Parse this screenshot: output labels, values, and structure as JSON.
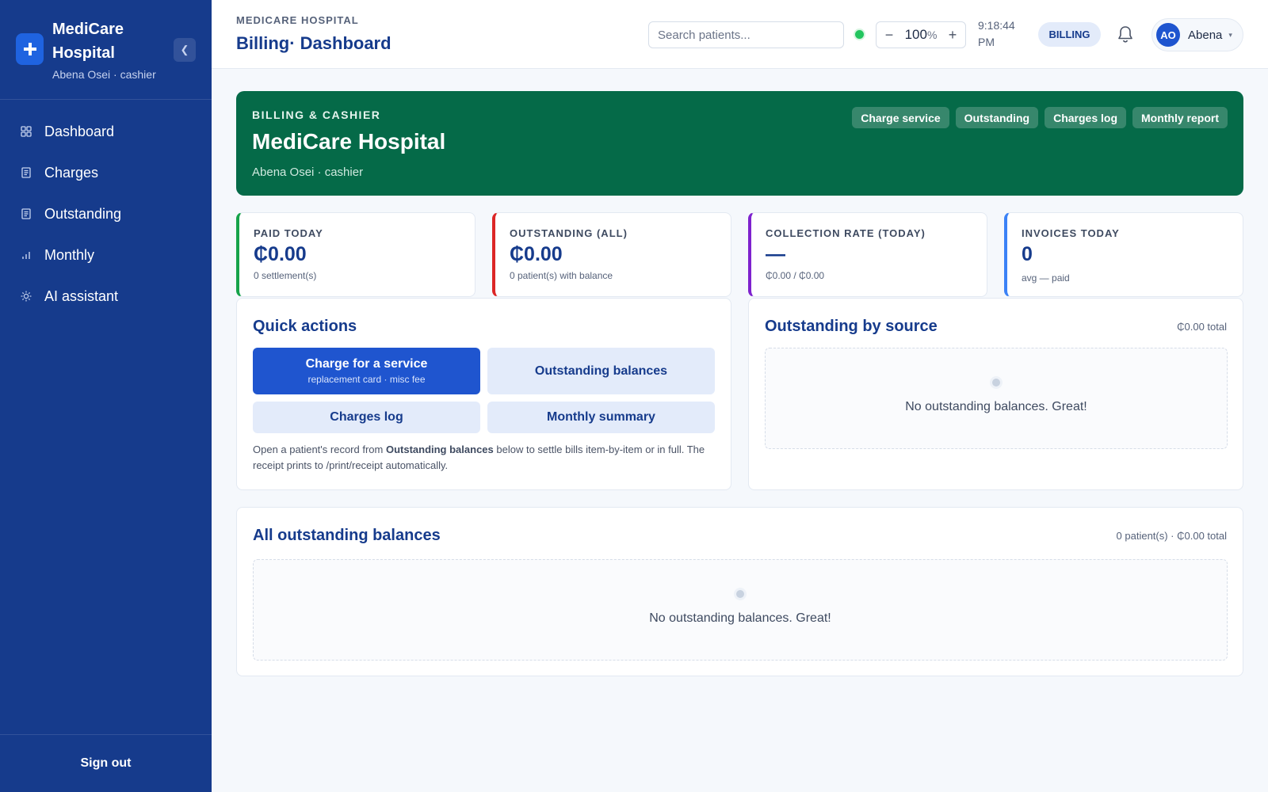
{
  "brand": {
    "name": "MediCare Hospital",
    "user_line": "Abena Osei · cashier"
  },
  "sidebar": {
    "collapse_icon": "chevron-left-icon",
    "items": [
      {
        "label": "Dashboard",
        "icon": "grid-icon"
      },
      {
        "label": "Charges",
        "icon": "receipt-icon"
      },
      {
        "label": "Outstanding",
        "icon": "receipt-icon"
      },
      {
        "label": "Monthly",
        "icon": "bar-chart-icon"
      },
      {
        "label": "AI assistant",
        "icon": "sun-icon"
      }
    ],
    "sign_out": "Sign out"
  },
  "topbar": {
    "breadcrumb": "MEDICARE HOSPITAL",
    "title": "Billing· Dashboard",
    "search_placeholder": "Search patients...",
    "status": "online",
    "zoom": {
      "minus": "−",
      "value": "100",
      "unit": "%",
      "plus": "+"
    },
    "clock": "9:18:44 PM",
    "role": "BILLING",
    "user": {
      "initials": "AO",
      "name": "Abena",
      "caret": "▾"
    }
  },
  "hero": {
    "kicker": "BILLING & CASHIER",
    "title": "MediCare Hospital",
    "subtitle": "Abena Osei · cashier",
    "actions": [
      "Charge service",
      "Outstanding",
      "Charges log",
      "Monthly report"
    ]
  },
  "stats": [
    {
      "label": "PAID TODAY",
      "value": "₵0.00",
      "sub": "0 settlement(s)",
      "accent": "#16a34a"
    },
    {
      "label": "OUTSTANDING (ALL)",
      "value": "₵0.00",
      "sub": "0 patient(s) with balance",
      "accent": "#dc2626"
    },
    {
      "label": "COLLECTION RATE (TODAY)",
      "value": "—",
      "sub": "₵0.00 / ₵0.00",
      "accent": "#7e22ce"
    },
    {
      "label": "INVOICES TODAY",
      "value": "0",
      "sub": "avg — paid",
      "accent": "#3b82f6"
    }
  ],
  "quick_actions": {
    "title": "Quick actions",
    "primary": {
      "label": "Charge for a service",
      "sub": "replacement card · misc fee"
    },
    "outstanding_balances": "Outstanding balances",
    "charges_log": "Charges log",
    "monthly_summary": "Monthly summary",
    "note_before": "Open a patient's record from ",
    "note_bold": "Outstanding balances",
    "note_after": " below to settle bills item-by-item or in full. The receipt prints to /print/receipt automatically."
  },
  "outstanding_by_source": {
    "title": "Outstanding by source",
    "meta": "₵0.00 total",
    "empty": "No outstanding balances. Great!"
  },
  "all_outstanding": {
    "title": "All outstanding balances",
    "meta": "0 patient(s) · ₵0.00 total",
    "empty": "No outstanding balances. Great!"
  },
  "colors": {
    "sidebar": "#163b8c",
    "accent": "#1f55cf",
    "hero": "#056a48",
    "status_online": "#22c55e"
  }
}
